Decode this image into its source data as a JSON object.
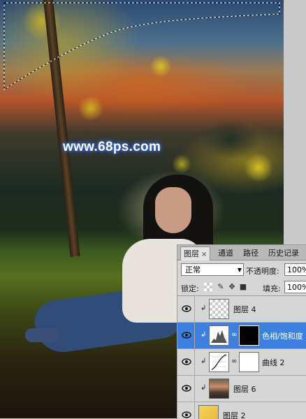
{
  "watermark": "www.68ps.com",
  "layers_panel": {
    "tabs": [
      {
        "label": "图层",
        "active": true,
        "has_close": true,
        "close_glyph": "×"
      },
      {
        "label": "通道",
        "active": false
      },
      {
        "label": "路径",
        "active": false
      },
      {
        "label": "历史记录",
        "active": false
      }
    ],
    "blend_mode": "正常",
    "opacity_label": "不透明度:",
    "opacity_value": "100%",
    "lock_label": "锁定:",
    "lock_icons": [
      "lock-transparent-icon",
      "lock-brush-icon",
      "lock-move-icon",
      "lock-all-icon"
    ],
    "fill_label": "填充:",
    "fill_value": "100%",
    "layers": [
      {
        "name": "图层 4",
        "visible": true,
        "clipped": true,
        "thumbnail": "transparent",
        "has_mask": false,
        "selected": false
      },
      {
        "name": "色相/饱和度",
        "visible": true,
        "clipped": true,
        "thumbnail": "hue-saturation-adjustment",
        "has_mask": true,
        "mask": "dark",
        "selected": true
      },
      {
        "name": "曲线 2",
        "visible": true,
        "clipped": true,
        "thumbnail": "curves-adjustment",
        "has_mask": true,
        "mask": "white",
        "selected": false
      },
      {
        "name": "图层 6",
        "visible": true,
        "clipped": true,
        "thumbnail": "photo",
        "has_mask": false,
        "selected": false
      },
      {
        "name": "图层 2",
        "visible": true,
        "clipped": false,
        "thumbnail": "yellow-fill",
        "has_mask": false,
        "selected": false
      }
    ]
  },
  "colors": {
    "selection_highlight": "#3d80df",
    "watermark_glow": "#3a6fe0"
  }
}
